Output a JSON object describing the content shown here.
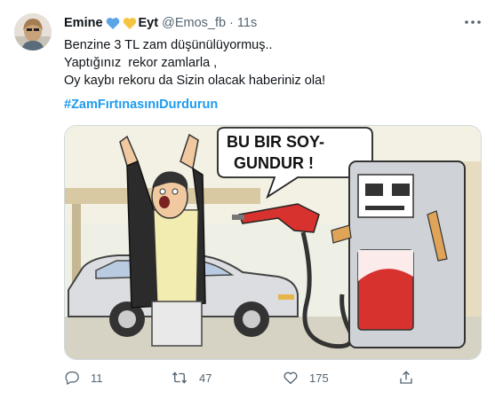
{
  "tweet": {
    "display_name": "Emine",
    "display_name_suffix": "Eyt",
    "handle": "@Emos_fb",
    "separator": "·",
    "time": "11s",
    "text_lines": [
      "Benzine 3 TL zam düşünülüyormuş..",
      "Yaptığınız  rekor zamlarla ,",
      "Oy kaybı rekoru da Sizin olacak haberiniz ola!"
    ],
    "hashtag": "#ZamFırtınasınıDurdurun",
    "name_hearts": [
      "blue-heart-icon",
      "yellow-heart-icon"
    ],
    "colors": {
      "accent": "#1d9bf0",
      "secondary_text": "#536471",
      "heart_blue": "#5ba4e6",
      "heart_yellow": "#f5c542"
    }
  },
  "media": {
    "speech_text_line1": "BU BIR SOY-",
    "speech_text_line2": "GUNDUR !"
  },
  "actions": {
    "reply_count": "11",
    "retweet_count": "47",
    "like_count": "175",
    "icons": [
      "reply-icon",
      "retweet-icon",
      "like-icon",
      "share-icon"
    ]
  }
}
